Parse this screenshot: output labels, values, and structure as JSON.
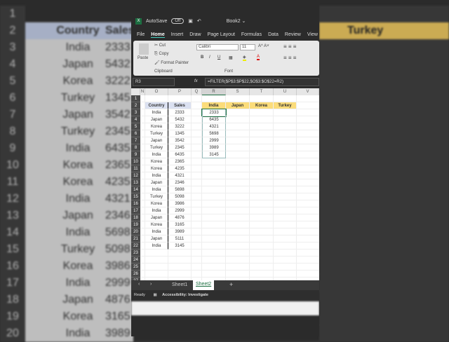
{
  "background": {
    "header": [
      "Country",
      "Sales"
    ],
    "right_header": "Turkey",
    "rows": [
      [
        "India",
        "2333"
      ],
      [
        "Japan",
        "5432"
      ],
      [
        "Korea",
        "3222"
      ],
      [
        "Turkey",
        "1345"
      ],
      [
        "Japan",
        "3542"
      ],
      [
        "Turkey",
        "2345"
      ],
      [
        "India",
        "6435"
      ],
      [
        "Korea",
        "2365"
      ],
      [
        "Korea",
        "4235"
      ],
      [
        "India",
        "4321"
      ],
      [
        "Japan",
        "2346"
      ],
      [
        "India",
        "5698"
      ],
      [
        "Turkey",
        "5098"
      ],
      [
        "Korea",
        "3986"
      ],
      [
        "India",
        "2999"
      ],
      [
        "Japan",
        "4876"
      ],
      [
        "Korea",
        "3165"
      ],
      [
        "India",
        "3989"
      ]
    ]
  },
  "titlebar": {
    "autosave": "AutoSave",
    "toggle": "Off",
    "book": "Book2 ⌄"
  },
  "menu": [
    "File",
    "Home",
    "Insert",
    "Draw",
    "Page Layout",
    "Formulas",
    "Data",
    "Review",
    "View"
  ],
  "ribbon": {
    "paste": "Paste",
    "cut": "Cut",
    "copy": "Copy",
    "format_painter": "Format Painter",
    "clipboard": "Clipboard",
    "font_name": "Calibri",
    "font_size": "11",
    "font": "Font",
    "bold": "B",
    "italic": "I",
    "underline": "U"
  },
  "formula_bar": {
    "name_box": "R3",
    "fx": "fx",
    "formula": "=FILTER($P$3:$P$22,$O$3:$O$22=R2)"
  },
  "columns": [
    "N",
    "O",
    "P",
    "Q",
    "R",
    "S",
    "T",
    "U",
    "V"
  ],
  "table": {
    "headers": [
      "Country",
      "Sales"
    ],
    "rows": [
      [
        "India",
        "2333"
      ],
      [
        "Japan",
        "5432"
      ],
      [
        "Korea",
        "3222"
      ],
      [
        "Turkey",
        "1345"
      ],
      [
        "Japan",
        "3542"
      ],
      [
        "Turkey",
        "2345"
      ],
      [
        "India",
        "6435"
      ],
      [
        "Korea",
        "2365"
      ],
      [
        "Korea",
        "4235"
      ],
      [
        "India",
        "4321"
      ],
      [
        "Japan",
        "2346"
      ],
      [
        "India",
        "5698"
      ],
      [
        "Turkey",
        "5098"
      ],
      [
        "Korea",
        "3986"
      ],
      [
        "India",
        "2999"
      ],
      [
        "Japan",
        "4876"
      ],
      [
        "Korea",
        "3165"
      ],
      [
        "India",
        "3989"
      ],
      [
        "Japan",
        "5111"
      ],
      [
        "India",
        "3145"
      ]
    ]
  },
  "filter": {
    "headers": [
      "India",
      "Japan",
      "Korea",
      "Turkey"
    ],
    "results": [
      "2333",
      "6435",
      "4321",
      "5698",
      "2999",
      "3989",
      "3145"
    ]
  },
  "sheet_tabs": [
    "Sheet1",
    "Sheet2"
  ],
  "add_sheet": "+",
  "status": {
    "ready": "Ready",
    "accessibility": "Accessibility: Investigate"
  }
}
